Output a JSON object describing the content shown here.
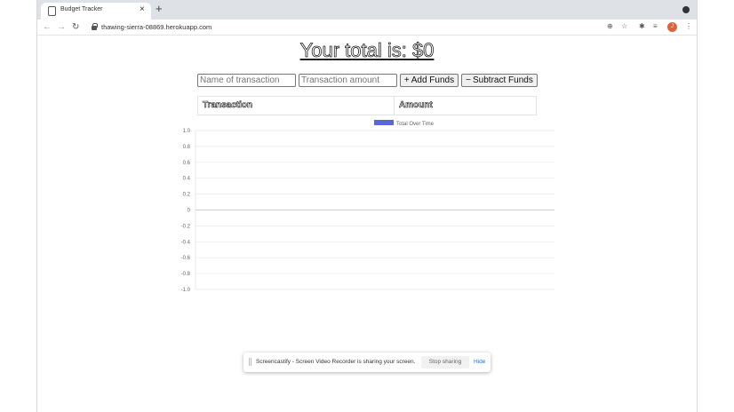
{
  "browser": {
    "tab_title": "Budget Tracker",
    "tab_close": "×",
    "new_tab": "+",
    "url": "thawing-sierra-08869.herokuapp.com",
    "avatar_letter": "J",
    "nav_back": "←",
    "nav_forward": "→",
    "nav_reload": "↻"
  },
  "page": {
    "total_text": "Your total is: $0",
    "name_placeholder": "Name of transaction",
    "amount_placeholder": "Transaction amount",
    "add_icon": "+",
    "add_label": "Add Funds",
    "sub_icon": "−",
    "sub_label": "Subtract Funds",
    "table_headers": [
      "Transaction",
      "Amount"
    ]
  },
  "chart_data": {
    "type": "line",
    "legend": "Total Over Time",
    "series_color": "#5a67d8",
    "ylim": [
      -1.0,
      1.0
    ],
    "yticks": [
      "1.0",
      "0.8",
      "0.6",
      "0.4",
      "0.2",
      "0",
      "-0.2",
      "-0.4",
      "-0.6",
      "-0.8",
      "-1.0"
    ],
    "x": [],
    "values": [],
    "grid": true
  },
  "screencastify": {
    "message": "Screencastify - Screen Video Recorder is sharing your screen.",
    "stop_label": "Stop sharing",
    "hide_label": "Hide"
  }
}
